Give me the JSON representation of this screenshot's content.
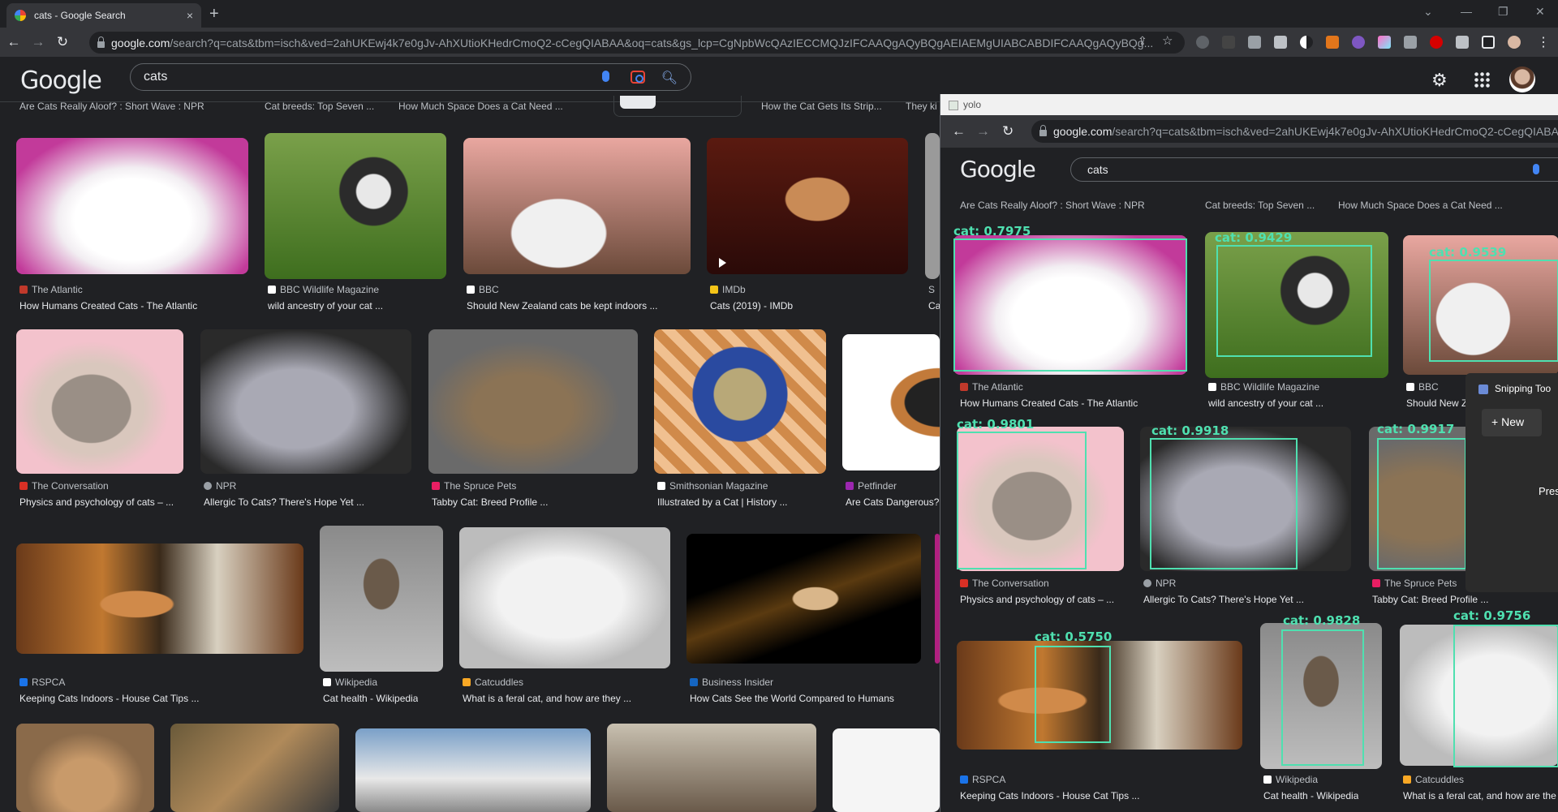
{
  "browser": {
    "tab_title": "cats - Google Search",
    "new_tab": "+",
    "tab_close": "×",
    "url_host": "google.com",
    "url_rest": "/search?q=cats&tbm=isch&ved=2ahUKEwj4k7e0gJv-AhXUtioKHedrCmoQ2-cCegQIABAA&oq=cats&gs_lcp=CgNpbWcQAzIECCMQJzIFCAAQgAQyBQgAEIAEMgUIABCABDIFCAAQgAQyBQg...",
    "win_min": "—",
    "win_max": "❐",
    "win_close": "✕"
  },
  "google": {
    "logo": "Google",
    "query": "cats"
  },
  "top_row": [
    "Are Cats Really Aloof? : Short Wave : NPR",
    "Cat breeds: Top Seven ...",
    "How Much Space Does a Cat Need ...",
    "How the Cat Gets Its Strip...",
    "They ki"
  ],
  "row1": [
    {
      "source": "The Atlantic",
      "caption": "How Humans Created Cats - The Atlantic",
      "color": "#c0392b"
    },
    {
      "source": "BBC Wildlife Magazine",
      "caption": "wild ancestry of your cat ...",
      "color": "#ffffff"
    },
    {
      "source": "BBC",
      "caption": "Should New Zealand cats be kept indoors ...",
      "color": "#ffffff"
    },
    {
      "source": "IMDb",
      "caption": "Cats (2019) - IMDb",
      "color": "#f5c518"
    },
    {
      "source": "S",
      "caption": "Ca",
      "color": "#ffffff"
    }
  ],
  "row2": [
    {
      "source": "The Conversation",
      "caption": "Physics and psychology of cats – ...",
      "color": "#d93025"
    },
    {
      "source": "NPR",
      "caption": "Allergic To Cats? There's Hope Yet ...",
      "color": "#9aa0a6"
    },
    {
      "source": "The Spruce Pets",
      "caption": "Tabby Cat: Breed Profile ...",
      "color": "#e91e63"
    },
    {
      "source": "Smithsonian Magazine",
      "caption": "Illustrated by a Cat | History ...",
      "color": "#ffffff"
    },
    {
      "source": "Petfinder",
      "caption": "Are Cats Dangerous?",
      "color": "#9c27b0"
    }
  ],
  "row3": [
    {
      "source": "RSPCA",
      "caption": "Keeping Cats Indoors - House Cat Tips ...",
      "color": "#1a73e8"
    },
    {
      "source": "Wikipedia",
      "caption": "Cat health - Wikipedia",
      "color": "#ffffff"
    },
    {
      "source": "Catcuddles",
      "caption": "What is a feral cat, and how are they ...",
      "color": "#f9a825"
    },
    {
      "source": "Business Insider",
      "caption": "How Cats See the World Compared to Humans",
      "color": "#1565c0"
    }
  ],
  "yolo": {
    "title": "yolo",
    "url_host": "google.com",
    "url_rest": "/search?q=cats&tbm=isch&ved=2ahUKEwj4k7e0gJv-AhXUtioKHedrCmoQ2-cCegQIABAA",
    "logo": "Google",
    "query": "cats",
    "top_row": [
      "Are Cats Really Aloof? : Short Wave : NPR",
      "Cat breeds: Top Seven ...",
      "How Much Space Does a Cat Need ..."
    ],
    "detections": [
      "cat: 0.7975",
      "cat: 0.9429",
      "cat: 0.9539",
      "cat: 0.9801",
      "cat: 0.9918",
      "cat: 0.9917",
      "cat: 0.5750",
      "cat: 0.9828",
      "cat: 0.9756"
    ],
    "row1": [
      {
        "source": "The Atlantic",
        "caption": "How Humans Created Cats - The Atlantic"
      },
      {
        "source": "BBC Wildlife Magazine",
        "caption": "wild ancestry of your cat ..."
      },
      {
        "source": "BBC",
        "caption": "Should New Z"
      }
    ],
    "row2": [
      {
        "source": "The Conversation",
        "caption": "Physics and psychology of cats – ..."
      },
      {
        "source": "NPR",
        "caption": "Allergic To Cats? There's Hope Yet ..."
      },
      {
        "source": "The Spruce Pets",
        "caption": "Tabby Cat: Breed Profile ..."
      }
    ],
    "row3": [
      {
        "source": "RSPCA",
        "caption": "Keeping Cats Indoors - House Cat Tips ..."
      },
      {
        "source": "Wikipedia",
        "caption": "Cat health - Wikipedia"
      },
      {
        "source": "Catcuddles",
        "caption": "What is a feral cat, and how are the"
      }
    ]
  },
  "snipping": {
    "title": "Snipping Too",
    "new_label": "New",
    "press": "Pres"
  },
  "colors": {
    "accent_box": "#4fe0b0",
    "background": "#202124"
  }
}
